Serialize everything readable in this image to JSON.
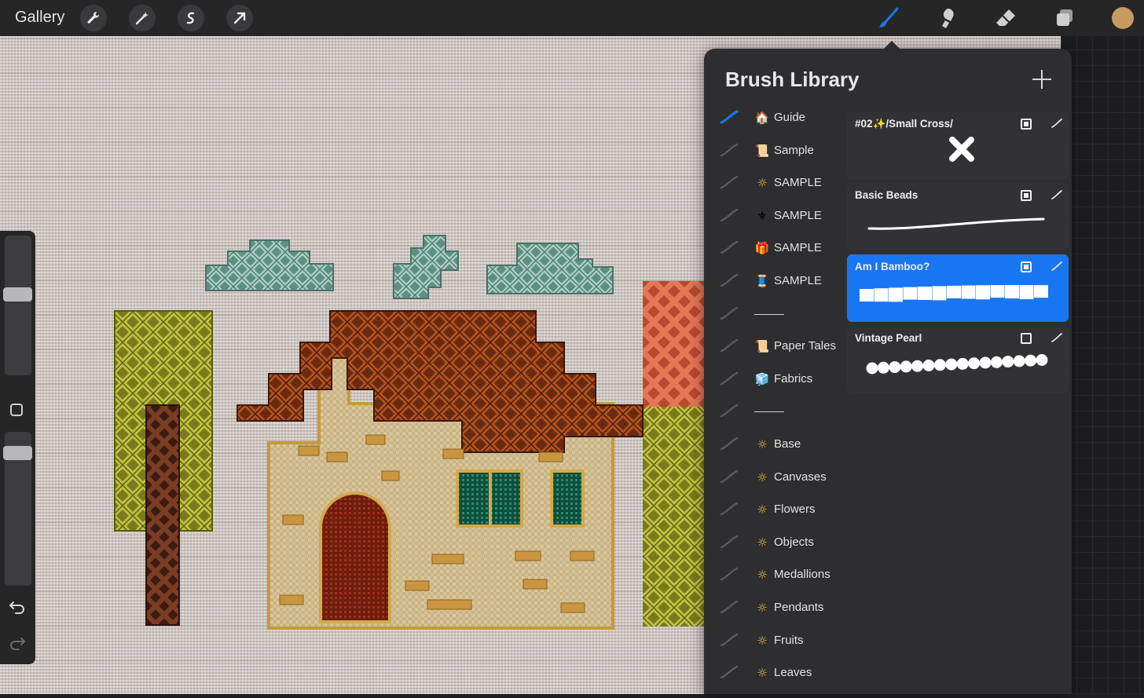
{
  "topbar": {
    "gallery_label": "Gallery",
    "left_tools": [
      "wrench-icon",
      "magic-wand-icon",
      "selection-icon",
      "transform-arrow-icon"
    ],
    "right_tools": [
      "brush-icon",
      "smudge-icon",
      "eraser-icon",
      "layers-icon",
      "color-swatch"
    ],
    "active_tool": "brush-icon",
    "accent_color": "#1976f2",
    "current_color": "#c79a62"
  },
  "left_sidebar": {
    "controls": [
      "brush-size-slider",
      "modify-button",
      "opacity-slider",
      "undo-icon",
      "redo-icon"
    ]
  },
  "brush_library": {
    "title": "Brush Library",
    "sets": [
      {
        "icon": "🏠",
        "label": "Guide",
        "selected": true
      },
      {
        "icon": "📜",
        "label": "Sample"
      },
      {
        "icon": "☼",
        "label": "SAMPLE"
      },
      {
        "icon": "⚜",
        "label": "SAMPLE"
      },
      {
        "icon": "🎁",
        "label": "SAMPLE"
      },
      {
        "icon": "🧵",
        "label": "SAMPLE"
      },
      {
        "icon": "",
        "label": "———"
      },
      {
        "icon": "📜",
        "label": "Paper Tales"
      },
      {
        "icon": "🧊",
        "label": "Fabrics"
      },
      {
        "icon": "",
        "label": "———"
      },
      {
        "icon": "☼",
        "label": "Base"
      },
      {
        "icon": "☼",
        "label": "Canvases"
      },
      {
        "icon": "☼",
        "label": "Flowers"
      },
      {
        "icon": "☼",
        "label": "Objects"
      },
      {
        "icon": "☼",
        "label": "Medallions"
      },
      {
        "icon": "☼",
        "label": "Pendants"
      },
      {
        "icon": "☼",
        "label": "Fruits"
      },
      {
        "icon": "☼",
        "label": "Leaves"
      }
    ],
    "brushes": [
      {
        "name": "#02✨/Small Cross/",
        "preview": "cross",
        "selected": false
      },
      {
        "name": "Basic Beads",
        "preview": "line",
        "selected": false
      },
      {
        "name": "Am I Bamboo?",
        "preview": "bamboo",
        "selected": true
      },
      {
        "name": "Vintage Pearl",
        "preview": "pearls",
        "selected": false
      }
    ]
  }
}
